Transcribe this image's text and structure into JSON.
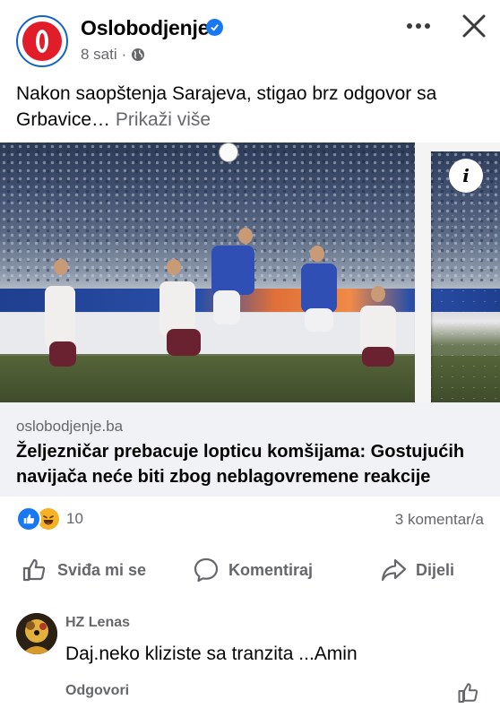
{
  "post": {
    "page_name": "Oslobodjenje",
    "time": "8 sati",
    "separator": "·",
    "text": "Nakon saopštenja Sarajeva, stigao brz odgovor sa Grbavice…",
    "see_more": "Prikaži više"
  },
  "link": {
    "domain": "oslobodjenje.ba",
    "title": "Željezničar prebacuje lopticu komšijama: Gostujućih navijača neće biti zbog neblagovremene reakcije"
  },
  "engagement": {
    "reaction_count": "10",
    "comments_count": "3 komentar/a"
  },
  "actions": {
    "like": "Sviđa mi se",
    "comment": "Komentiraj",
    "share": "Dijeli"
  },
  "comment": {
    "author": "HZ Lenas",
    "text": "Daj.neko kliziste sa tranzita ...Amin",
    "reply": "Odgovori"
  },
  "colors": {
    "brand_red": "#e11d2a",
    "accent_blue": "#1877f2",
    "secondary_text": "#65676b"
  },
  "icons": [
    "verified-badge-icon",
    "globe-icon",
    "more-icon",
    "close-icon",
    "info-icon",
    "like-reaction-icon",
    "haha-reaction-icon",
    "thumbs-up-icon",
    "comment-bubble-icon",
    "share-arrow-icon"
  ]
}
